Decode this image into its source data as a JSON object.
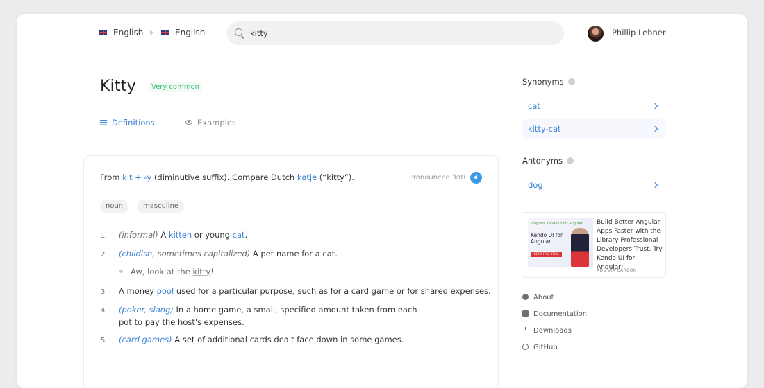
{
  "header": {
    "source_language": "English",
    "target_language": "English",
    "search": {
      "value": "kitty",
      "placeholder": ""
    },
    "user_name": "Phillip Lehner"
  },
  "entry": {
    "word": "Kitty",
    "frequency": "Very common",
    "tabs": [
      {
        "label": "Definitions",
        "active": true
      },
      {
        "label": "Examples",
        "active": false
      }
    ],
    "etymology": {
      "prefix": "From ",
      "link1": "kit",
      "plus": " + ",
      "link2": "-y",
      "middle": " (diminutive suffix). Compare Dutch ",
      "link3": "katje",
      "suffix": " (“kitty”)."
    },
    "pronunciation": "Pronounced ˈkɪti",
    "tags": [
      "noun",
      "masculine"
    ],
    "definitions": [
      {
        "num": "1",
        "context": "(informal)",
        "pre": " A ",
        "link1": "kitten",
        "mid": " or young ",
        "link2": "cat",
        "post": "."
      },
      {
        "num": "2",
        "context": "(childish",
        "context_rest": ", sometimes capitalized)",
        "text": " A pet name for a cat.",
        "example_pre": "Aw, look at the ",
        "example_word": "kitty",
        "example_post": "!"
      },
      {
        "num": "3",
        "pre": "A money ",
        "link": "pool",
        "post": " used for a particular purpose, such as for a card game or for shared expenses."
      },
      {
        "num": "4",
        "context": "(poker, slang)",
        "line1": " In a home game, a small, specified amount taken from each",
        "line2": "pot to pay the host's expenses."
      },
      {
        "num": "5",
        "context": "(card games)",
        "text": " A set of additional cards dealt face down in some games."
      }
    ]
  },
  "sidebar": {
    "synonyms_title": "Synonyms",
    "synonyms": [
      "cat",
      "kitty-cat"
    ],
    "antonyms_title": "Antonyms",
    "antonyms": [
      "dog"
    ],
    "ad": {
      "brand": "Progress Kendo UI for Angular",
      "logo": "Kendo UI for Angular",
      "cta": "GET A FREE TRIAL",
      "text": "Build Better Angular Apps Faster with the Library Professional Developers Trust. Try Kendo UI for Angular!",
      "via": "ADS VIA CARBON"
    },
    "links": [
      "About",
      "Documentation",
      "Downloads",
      "GitHub"
    ]
  },
  "colors": {
    "accent": "#3b82d6",
    "frequency": "#2fbf71"
  }
}
